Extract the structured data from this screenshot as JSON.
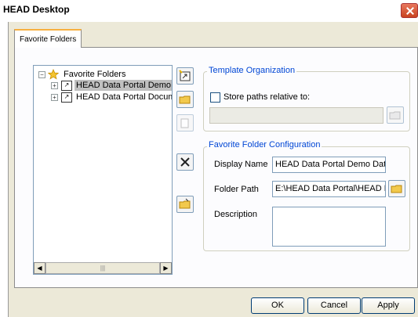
{
  "window": {
    "title": "HEAD Desktop"
  },
  "tabs": [
    {
      "label": "Favorite Folders"
    }
  ],
  "tree": {
    "root_label": "Favorite Folders",
    "items": [
      {
        "label": "HEAD Data Portal Demo Data",
        "selected": true
      },
      {
        "label": "HEAD Data Portal Documents",
        "selected": false
      }
    ],
    "scroll_thumb_glyph": "|||"
  },
  "template_org": {
    "legend": "Template Organization",
    "store_paths_label": "Store paths relative to:",
    "store_paths_checked": false,
    "path_value": ""
  },
  "folder_config": {
    "legend": "Favorite Folder Configuration",
    "display_name_label": "Display Name",
    "display_name_value": "HEAD Data Portal Demo Data",
    "folder_path_label": "Folder Path",
    "folder_path_value": "E:\\HEAD Data Portal\\HEAD Data Portal Demo Data",
    "description_label": "Description",
    "description_value": ""
  },
  "buttons": {
    "ok": "OK",
    "cancel": "Cancel",
    "apply": "Apply"
  }
}
